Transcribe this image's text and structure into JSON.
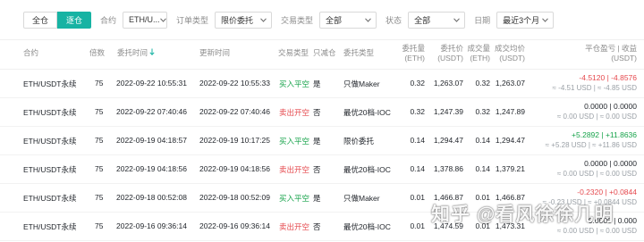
{
  "filters": {
    "margin_modes": [
      {
        "label": "全仓",
        "active": false
      },
      {
        "label": "逐仓",
        "active": true
      }
    ],
    "contract": {
      "label": "合约",
      "value": "ETH/U..."
    },
    "order_type": {
      "label": "订单类型",
      "value": "限价委托"
    },
    "trade_type": {
      "label": "交易类型",
      "value": "全部"
    },
    "status": {
      "label": "状态",
      "value": "全部"
    },
    "date": {
      "label": "日期",
      "value": "最近3个月"
    }
  },
  "table": {
    "headers": {
      "contract": "合约",
      "leverage": "倍数",
      "order_time": "委托时间",
      "update_time": "更新时间",
      "trade_type": "交易类型",
      "reduce_only": "只减仓",
      "order_type": "委托类型",
      "order_qty": "委托量",
      "order_qty_unit": "(ETH)",
      "order_price": "委托价",
      "order_price_unit": "(USDT)",
      "filled_qty": "成交量",
      "filled_qty_unit": "(ETH)",
      "avg_price": "成交均价",
      "avg_price_unit": "(USDT)",
      "pnl": "平仓盈亏 | 收益",
      "pnl_unit": "(USDT)"
    },
    "rows": [
      {
        "contract": "ETH/USDT永续",
        "leverage": "75",
        "order_time": "2022-09-22 10:55:31",
        "update_time": "2022-09-22 10:55:33",
        "trade_type": "买入平空",
        "side": "buy",
        "reduce_only": "是",
        "order_type": "只做Maker",
        "order_qty": "0.32",
        "order_price": "1,263.07",
        "filled_qty": "0.32",
        "avg_price": "1,263.07",
        "pnl_main": "-4.5120 | -4.8576",
        "pnl_sign": "neg",
        "pnl_sub": "≈ -4.51 USD | ≈ -4.85 USD"
      },
      {
        "contract": "ETH/USDT永续",
        "leverage": "75",
        "order_time": "2022-09-22 07:40:46",
        "update_time": "2022-09-22 07:40:46",
        "trade_type": "卖出开空",
        "side": "sell",
        "reduce_only": "否",
        "order_type": "最优20档-IOC",
        "order_qty": "0.32",
        "order_price": "1,247.39",
        "filled_qty": "0.32",
        "avg_price": "1,247.89",
        "pnl_main": "0.0000 | 0.0000",
        "pnl_sign": "zero",
        "pnl_sub": "≈ 0.00 USD | ≈ 0.00 USD"
      },
      {
        "contract": "ETH/USDT永续",
        "leverage": "75",
        "order_time": "2022-09-19 04:18:57",
        "update_time": "2022-09-19 10:17:25",
        "trade_type": "买入平空",
        "side": "buy",
        "reduce_only": "是",
        "order_type": "限价委托",
        "order_qty": "0.14",
        "order_price": "1,294.47",
        "filled_qty": "0.14",
        "avg_price": "1,294.47",
        "pnl_main": "+5.2892 | +11.8636",
        "pnl_sign": "pos",
        "pnl_sub": "≈ +5.28 USD | ≈ +11.86 USD"
      },
      {
        "contract": "ETH/USDT永续",
        "leverage": "75",
        "order_time": "2022-09-19 04:18:56",
        "update_time": "2022-09-19 04:18:56",
        "trade_type": "卖出开空",
        "side": "sell",
        "reduce_only": "否",
        "order_type": "最优20档-IOC",
        "order_qty": "0.14",
        "order_price": "1,378.86",
        "filled_qty": "0.14",
        "avg_price": "1,379.21",
        "pnl_main": "0.0000 | 0.0000",
        "pnl_sign": "zero",
        "pnl_sub": "≈ 0.00 USD | ≈ 0.00 USD"
      },
      {
        "contract": "ETH/USDT永续",
        "leverage": "75",
        "order_time": "2022-09-18 00:52:08",
        "update_time": "2022-09-18 00:52:09",
        "trade_type": "买入平空",
        "side": "buy",
        "reduce_only": "是",
        "order_type": "只做Maker",
        "order_qty": "0.01",
        "order_price": "1,466.87",
        "filled_qty": "0.01",
        "avg_price": "1,466.87",
        "pnl_main": "-0.2320 | +0.0844",
        "pnl_sign": "mixed",
        "pnl_sub": "≈ -0.23 USD | ≈ +0.0844 USD"
      },
      {
        "contract": "ETH/USDT永续",
        "leverage": "75",
        "order_time": "2022-09-16 09:36:14",
        "update_time": "2022-09-16 09:36:14",
        "trade_type": "卖出开空",
        "side": "sell",
        "reduce_only": "否",
        "order_type": "最优20档-IOC",
        "order_qty": "0.01",
        "order_price": "1,474.59",
        "filled_qty": "0.01",
        "avg_price": "1,473.31",
        "pnl_main": "0.0000 | 0.000",
        "pnl_sign": "zero",
        "pnl_sub": "≈ 0.00 USD | ≈ 0.00 USD"
      }
    ]
  },
  "watermark": {
    "text": "知乎 @看风徐徐几明"
  },
  "colors": {
    "accent": "#17b3a3",
    "buy": "#16a34a",
    "sell": "#e5484d",
    "muted": "#9aa0a6"
  }
}
